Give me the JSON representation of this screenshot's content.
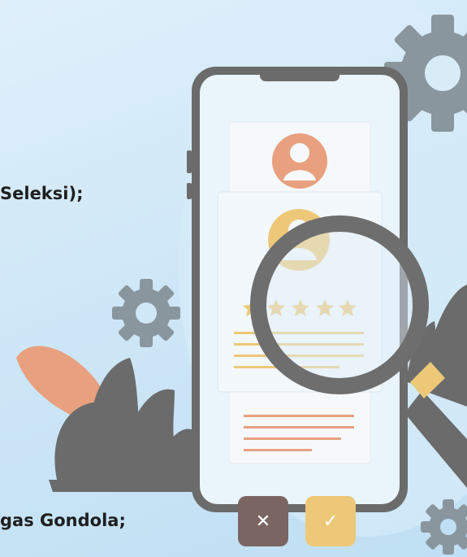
{
  "text_lines": [
    "Seleksi);",
    "gas Gondola;"
  ],
  "cut_line": "...",
  "rating": {
    "stars": 5
  },
  "buttons": {
    "reject_glyph": "✕",
    "accept_glyph": "✓"
  },
  "colors": {
    "background": "#d4eaf8",
    "phone_frame": "#6b6b6b",
    "accent_orange": "#e8a07f",
    "accent_gold": "#ecc878",
    "gear": "#8a969e",
    "magnifier": "#6e6e6e"
  },
  "icons": [
    "gear-icon",
    "magnifier-icon",
    "avatar-icon",
    "star-icon",
    "close-icon",
    "check-icon",
    "plant-decoration"
  ]
}
